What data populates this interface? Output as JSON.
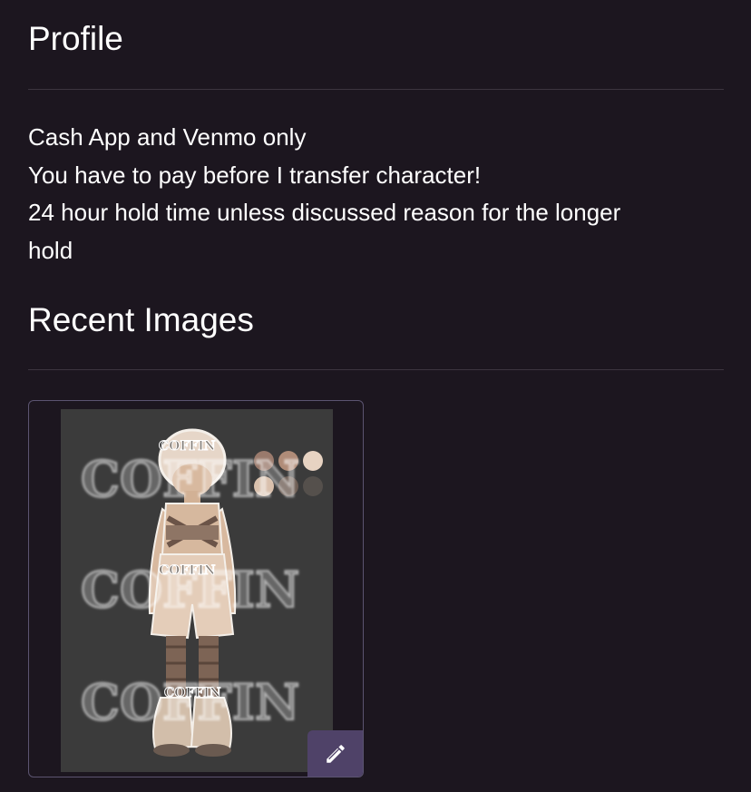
{
  "profile": {
    "heading": "Profile",
    "lines": [
      "Cash App and Venmo only",
      "You have to pay before I transfer character!",
      "24 hour hold time unless discussed reason for the longer",
      "hold"
    ]
  },
  "recent_images": {
    "heading": "Recent Images",
    "images": [
      {
        "watermark": "COFFIN",
        "edit_icon": "pencil-icon"
      }
    ]
  },
  "colors": {
    "background": "#1c161f",
    "divider": "#3c353f",
    "card_border": "#5b5470",
    "edit_button": "#4f4268",
    "thumbnail_bg": "#3b3b3b"
  }
}
